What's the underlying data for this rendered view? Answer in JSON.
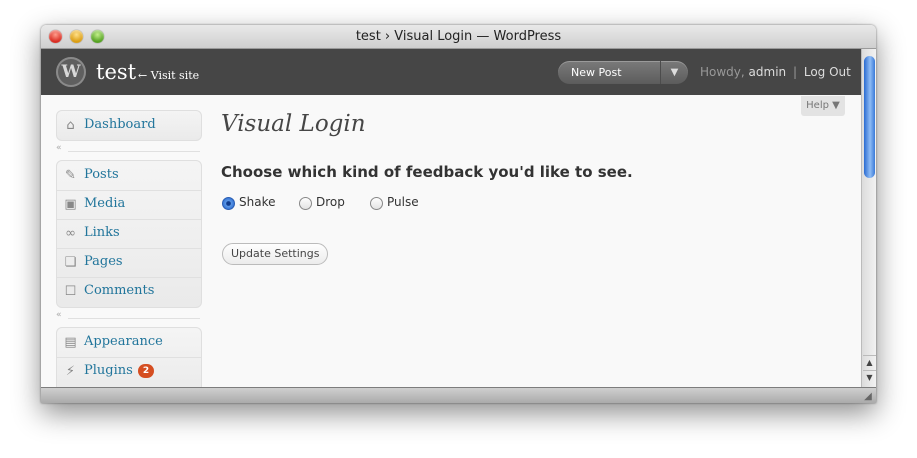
{
  "window": {
    "title": "test › Visual Login — WordPress"
  },
  "header": {
    "logo": "W",
    "site_name": "test",
    "visit_site": "← Visit site",
    "new_post": "New Post",
    "new_post_arrow": "▼",
    "howdy_prefix": "Howdy,",
    "username": "admin",
    "separator": "|",
    "logout": "Log Out"
  },
  "help": {
    "label": "Help ▼"
  },
  "sidebar": {
    "collapse_glyph": "«",
    "items": [
      {
        "label": "Dashboard",
        "icon": "⌂"
      },
      {
        "label": "Posts",
        "icon": "✎"
      },
      {
        "label": "Media",
        "icon": "▣"
      },
      {
        "label": "Links",
        "icon": "∞"
      },
      {
        "label": "Pages",
        "icon": "❏"
      },
      {
        "label": "Comments",
        "icon": "☐"
      },
      {
        "label": "Appearance",
        "icon": "▤"
      },
      {
        "label": "Plugins",
        "icon": "⚡",
        "badge": "2"
      }
    ]
  },
  "main": {
    "title": "Visual Login",
    "heading": "Choose which kind of feedback you'd like to see.",
    "options": [
      {
        "label": "Shake",
        "checked": true
      },
      {
        "label": "Drop",
        "checked": false
      },
      {
        "label": "Pulse",
        "checked": false
      }
    ],
    "submit": "Update Settings"
  },
  "colors": {
    "header_bg": "#464646",
    "link": "#21759b",
    "badge": "#d54e21",
    "page_bg": "#f9f9f9"
  }
}
